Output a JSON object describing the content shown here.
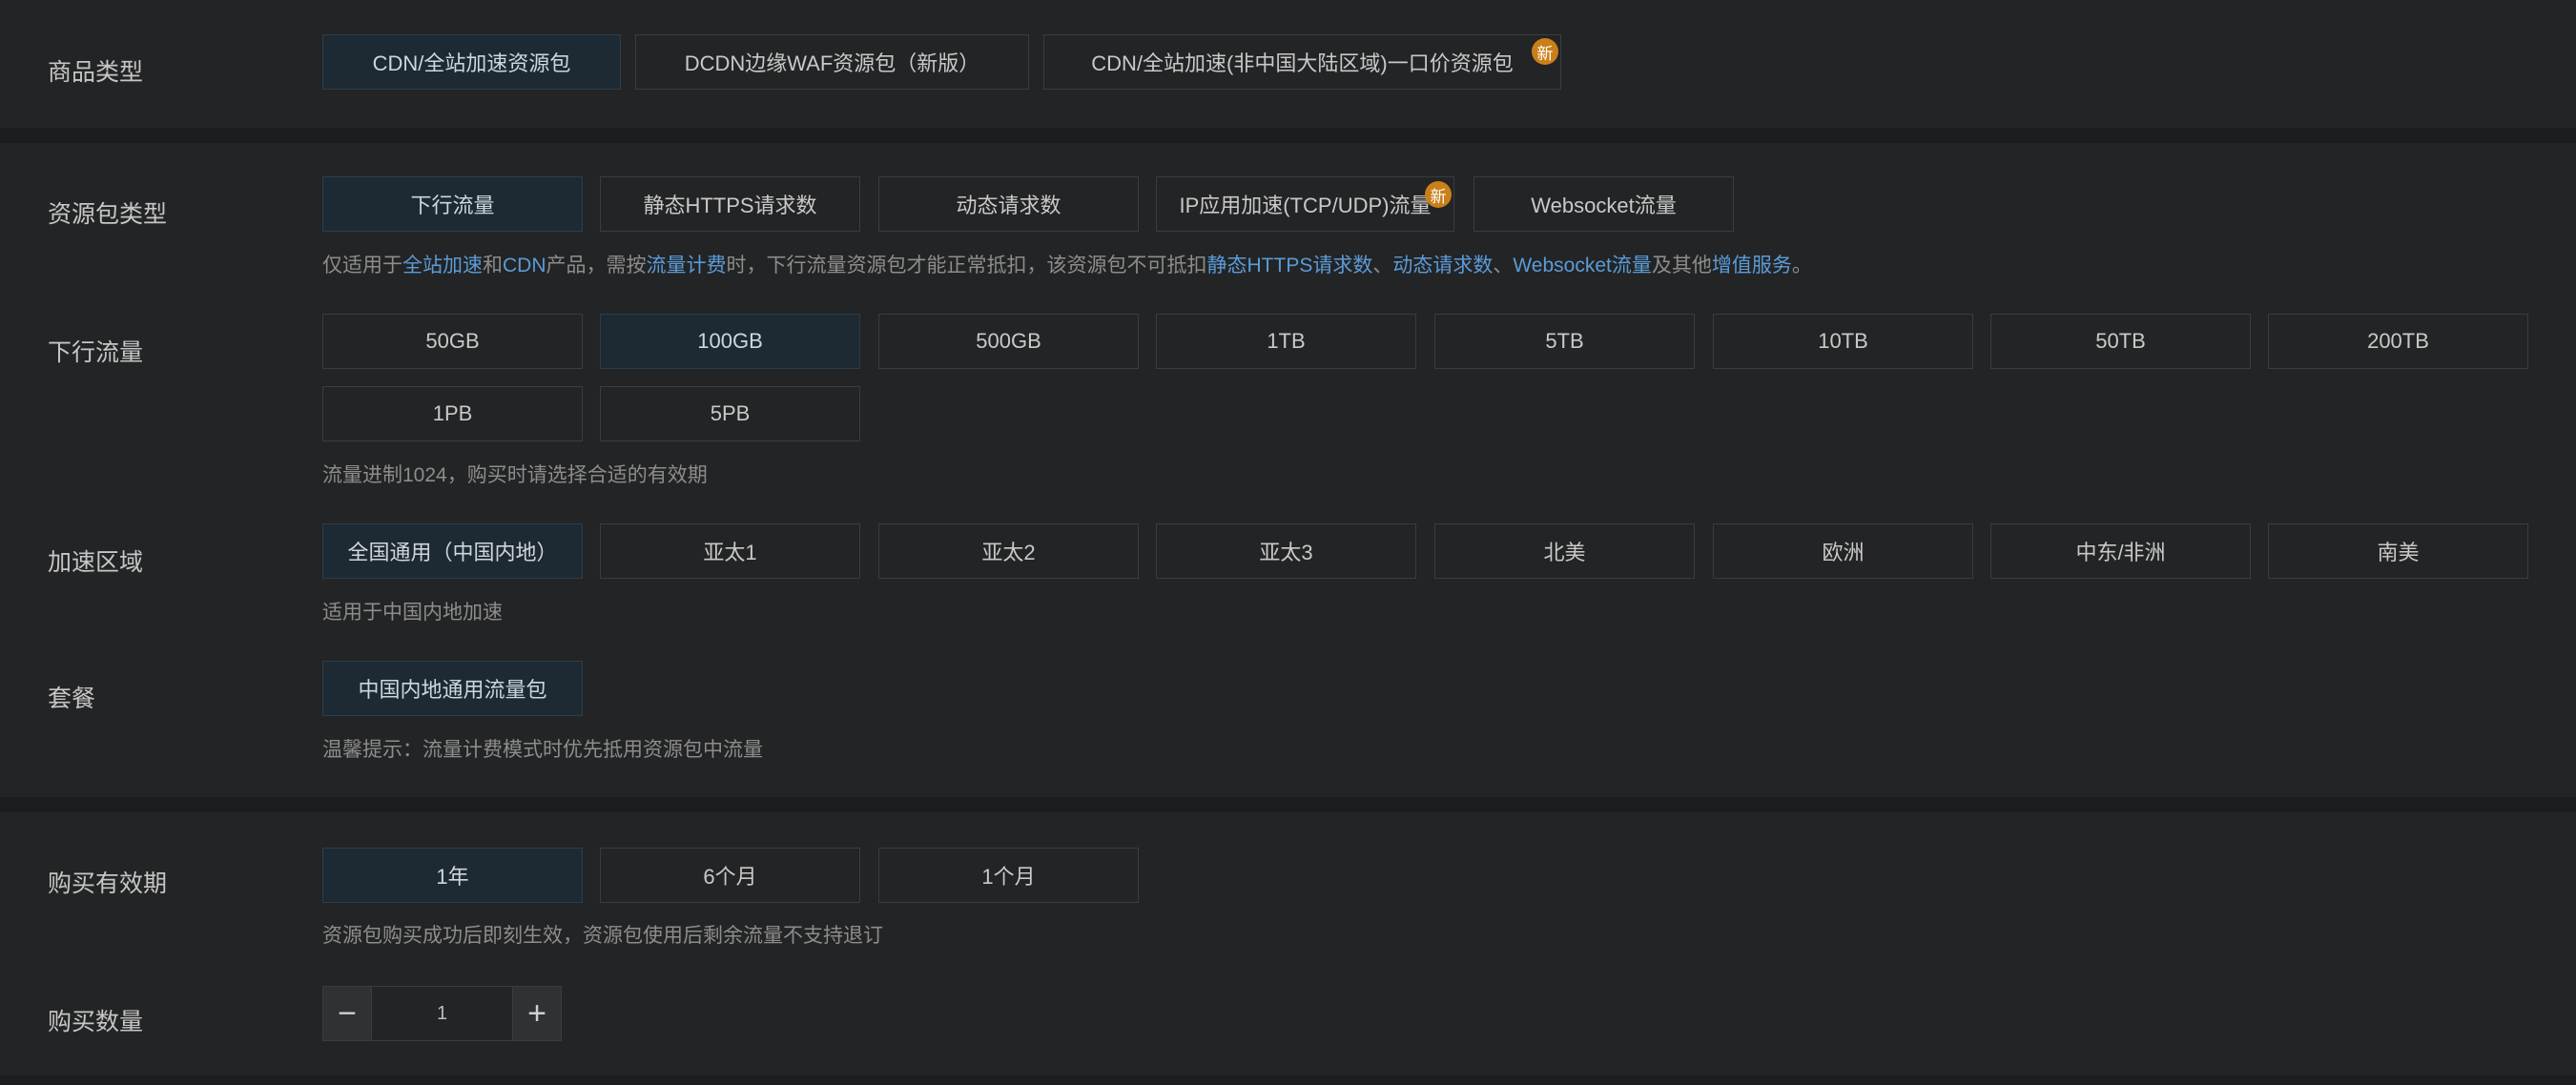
{
  "product_type": {
    "label": "商品类型",
    "options": [
      "CDN/全站加速资源包",
      "DCDN边缘WAF资源包（新版）",
      "CDN/全站加速(非中国大陆区域)一口价资源包"
    ],
    "badge": "新"
  },
  "package_type": {
    "label": "资源包类型",
    "options": [
      "下行流量",
      "静态HTTPS请求数",
      "动态请求数",
      "IP应用加速(TCP/UDP)流量",
      "Websocket流量"
    ],
    "badge": "新",
    "hint": {
      "t1": "仅适用于",
      "l1": "全站加速",
      "t2": "和",
      "l2": "CDN",
      "t3": "产品，需按",
      "l3": "流量计费",
      "t4": "时，下行流量资源包才能正常抵扣，该资源包不可抵扣",
      "l4": "静态HTTPS请求数",
      "t5": "、",
      "l5": "动态请求数",
      "t6": "、",
      "l6": "Websocket流量",
      "t7": "及其他",
      "l7": "增值服务",
      "t8": "。"
    }
  },
  "downlink": {
    "label": "下行流量",
    "options": [
      "50GB",
      "100GB",
      "500GB",
      "1TB",
      "5TB",
      "10TB",
      "50TB",
      "200TB",
      "1PB",
      "5PB"
    ],
    "hint": "流量进制1024，购买时请选择合适的有效期"
  },
  "region": {
    "label": "加速区域",
    "options": [
      "全国通用（中国内地）",
      "亚太1",
      "亚太2",
      "亚太3",
      "北美",
      "欧洲",
      "中东/非洲",
      "南美"
    ],
    "hint": "适用于中国内地加速"
  },
  "plan": {
    "label": "套餐",
    "options": [
      "中国内地通用流量包"
    ],
    "hint": "温馨提示：流量计费模式时优先抵用资源包中流量"
  },
  "validity": {
    "label": "购买有效期",
    "options": [
      "1年",
      "6个月",
      "1个月"
    ],
    "hint": "资源包购买成功后即刻生效，资源包使用后剩余流量不支持退订"
  },
  "quantity": {
    "label": "购买数量",
    "value": "1",
    "minus": "−",
    "plus": "+"
  }
}
